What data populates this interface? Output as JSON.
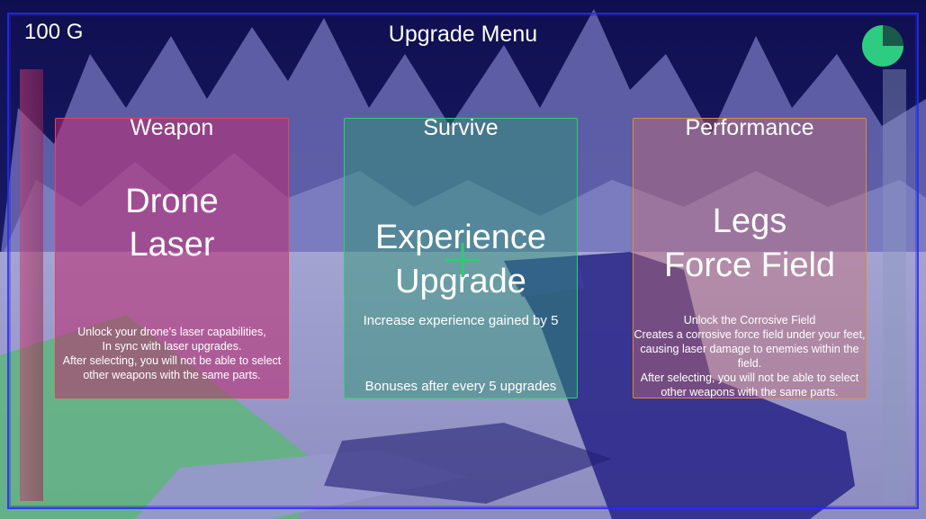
{
  "hud": {
    "gold": "100 G",
    "title": "Upgrade Menu"
  },
  "cards": [
    {
      "category": "Weapon",
      "name_line1": "Drone",
      "name_line2": "Laser",
      "description": [
        "Unlock your drone's laser capabilities,",
        "In sync with laser upgrades.",
        "After selecting, you will not be able to select",
        "other weapons with the same parts."
      ]
    },
    {
      "category": "Survive",
      "name_line1": "Experience",
      "name_line2": "Upgrade",
      "description": [
        "Increase experience gained by 5"
      ],
      "bonus": "Bonuses after every 5 upgrades"
    },
    {
      "category": "Performance",
      "name_line1": "Legs",
      "name_line2": "Force Field",
      "description": [
        "Unlock the Corrosive Field",
        "Creates a corrosive force field under your feet,",
        "causing laser damage to enemies within the",
        "field.",
        "After selecting, you will not be able to select",
        "other weapons with the same parts."
      ]
    }
  ],
  "colors": {
    "weapon": "#e0455a",
    "survive": "#30d070",
    "performance": "#e08a3a",
    "frame": "#2828ff"
  }
}
